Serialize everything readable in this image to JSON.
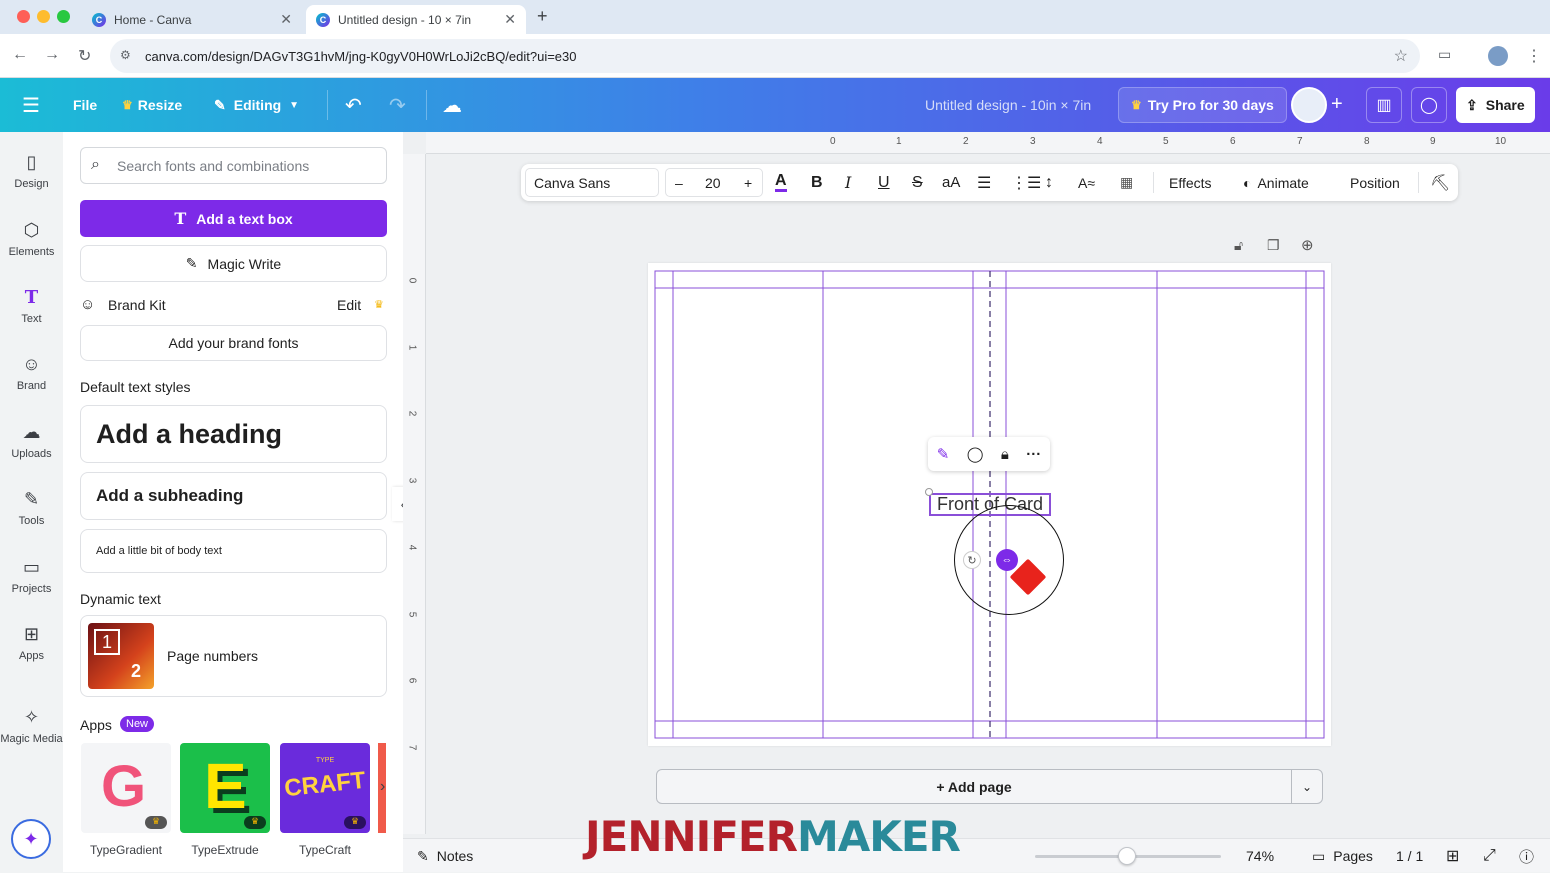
{
  "browser": {
    "tabs": [
      {
        "label": "Home - Canva"
      },
      {
        "label": "Untitled design - 10 × 7in"
      }
    ],
    "url": "canva.com/design/DAGvT3G1hvM/jng-K0gyV0H0WrLoJi2cBQ/edit?ui=e30"
  },
  "header": {
    "file": "File",
    "resize": "Resize",
    "editing": "Editing",
    "doc_title": "Untitled design - 10in × 7in",
    "try_pro": "Try Pro for 30 days",
    "share": "Share"
  },
  "rail": [
    {
      "label": "Design",
      "icon": "design-icon"
    },
    {
      "label": "Elements",
      "icon": "elements-icon"
    },
    {
      "label": "Text",
      "icon": "text-icon"
    },
    {
      "label": "Brand",
      "icon": "brand-icon"
    },
    {
      "label": "Uploads",
      "icon": "uploads-icon"
    },
    {
      "label": "Tools",
      "icon": "tools-icon"
    },
    {
      "label": "Projects",
      "icon": "projects-icon"
    },
    {
      "label": "Apps",
      "icon": "apps-icon"
    },
    {
      "label": "Magic Media",
      "icon": "magic-media-icon"
    }
  ],
  "panel": {
    "search_placeholder": "Search fonts and combinations",
    "add_text_box": "Add a text box",
    "magic_write": "Magic Write",
    "brand_kit": "Brand Kit",
    "brand_edit": "Edit",
    "add_brand_fonts": "Add your brand fonts",
    "default_styles_label": "Default text styles",
    "heading": "Add a heading",
    "subheading": "Add a subheading",
    "body": "Add a little bit of body text",
    "dynamic_label": "Dynamic text",
    "page_numbers": "Page numbers",
    "page_numbers_tile": [
      "1",
      "2"
    ],
    "apps_label": "Apps",
    "apps_badge": "New",
    "apps": [
      {
        "name": "TypeGradient",
        "tile_text": "G"
      },
      {
        "name": "TypeExtrude",
        "tile_text": "E"
      },
      {
        "name": "TypeCraft",
        "tile_text": "CRAFT",
        "tile_small": "TYPE"
      }
    ]
  },
  "toolbar": {
    "font": "Canva Sans",
    "size": "20",
    "minus": "–",
    "plus": "+",
    "case": "aA",
    "effects": "Effects",
    "animate": "Animate",
    "position": "Position"
  },
  "ruler": {
    "top": [
      "0",
      "1",
      "2",
      "3",
      "4",
      "5",
      "6",
      "7",
      "8",
      "9",
      "10"
    ],
    "left": [
      "0",
      "1",
      "2",
      "3",
      "4",
      "5",
      "6",
      "7"
    ]
  },
  "canvas": {
    "text_element": "Front of Card"
  },
  "footer": {
    "add_page": "+ Add page",
    "notes": "Notes",
    "zoom": "74%",
    "zoom_level": 0.74,
    "pages": "Pages",
    "page_count": "1 / 1"
  },
  "watermark": {
    "part1": "JENNIFER",
    "part2": "MAKER"
  },
  "colors": {
    "canva_purple": "#7d2ae8",
    "header_start": "#1bbcd6",
    "header_end": "#6a3ce9",
    "guide_purple": "#8a4fd8",
    "watermark_red": "#b3212b",
    "watermark_teal": "#2a8a9a"
  }
}
